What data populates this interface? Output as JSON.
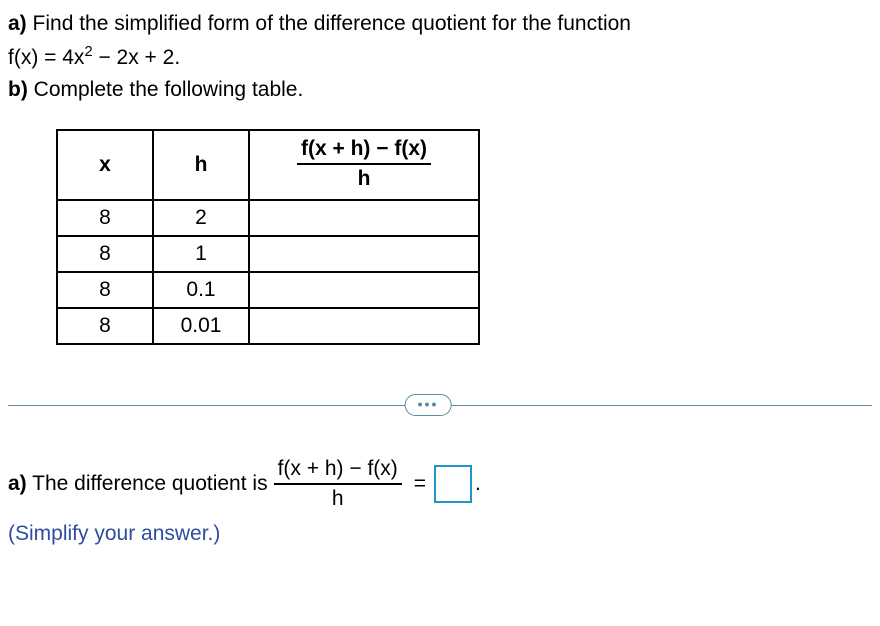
{
  "partA": {
    "label": "a)",
    "prompt": " Find the simplified form of the difference quotient for the function"
  },
  "function": {
    "prefix": "f(x) = 4x",
    "exponent": "2",
    "suffix": " − 2x + 2."
  },
  "partB": {
    "label": "b)",
    "prompt": " Complete the following table."
  },
  "table": {
    "headers": {
      "x": "x",
      "h": "h",
      "quotient_num": "f(x + h) − f(x)",
      "quotient_den": "h"
    },
    "rows": [
      {
        "x": "8",
        "h": "2",
        "q": ""
      },
      {
        "x": "8",
        "h": "1",
        "q": ""
      },
      {
        "x": "8",
        "h": "0.1",
        "q": ""
      },
      {
        "x": "8",
        "h": "0.01",
        "q": ""
      }
    ]
  },
  "expand": "•••",
  "answer": {
    "label": "a)",
    "text": " The difference quotient is ",
    "frac_num": "f(x + h) − f(x)",
    "frac_den": "h",
    "equals": "=",
    "period": "."
  },
  "hint": "(Simplify your answer.)"
}
